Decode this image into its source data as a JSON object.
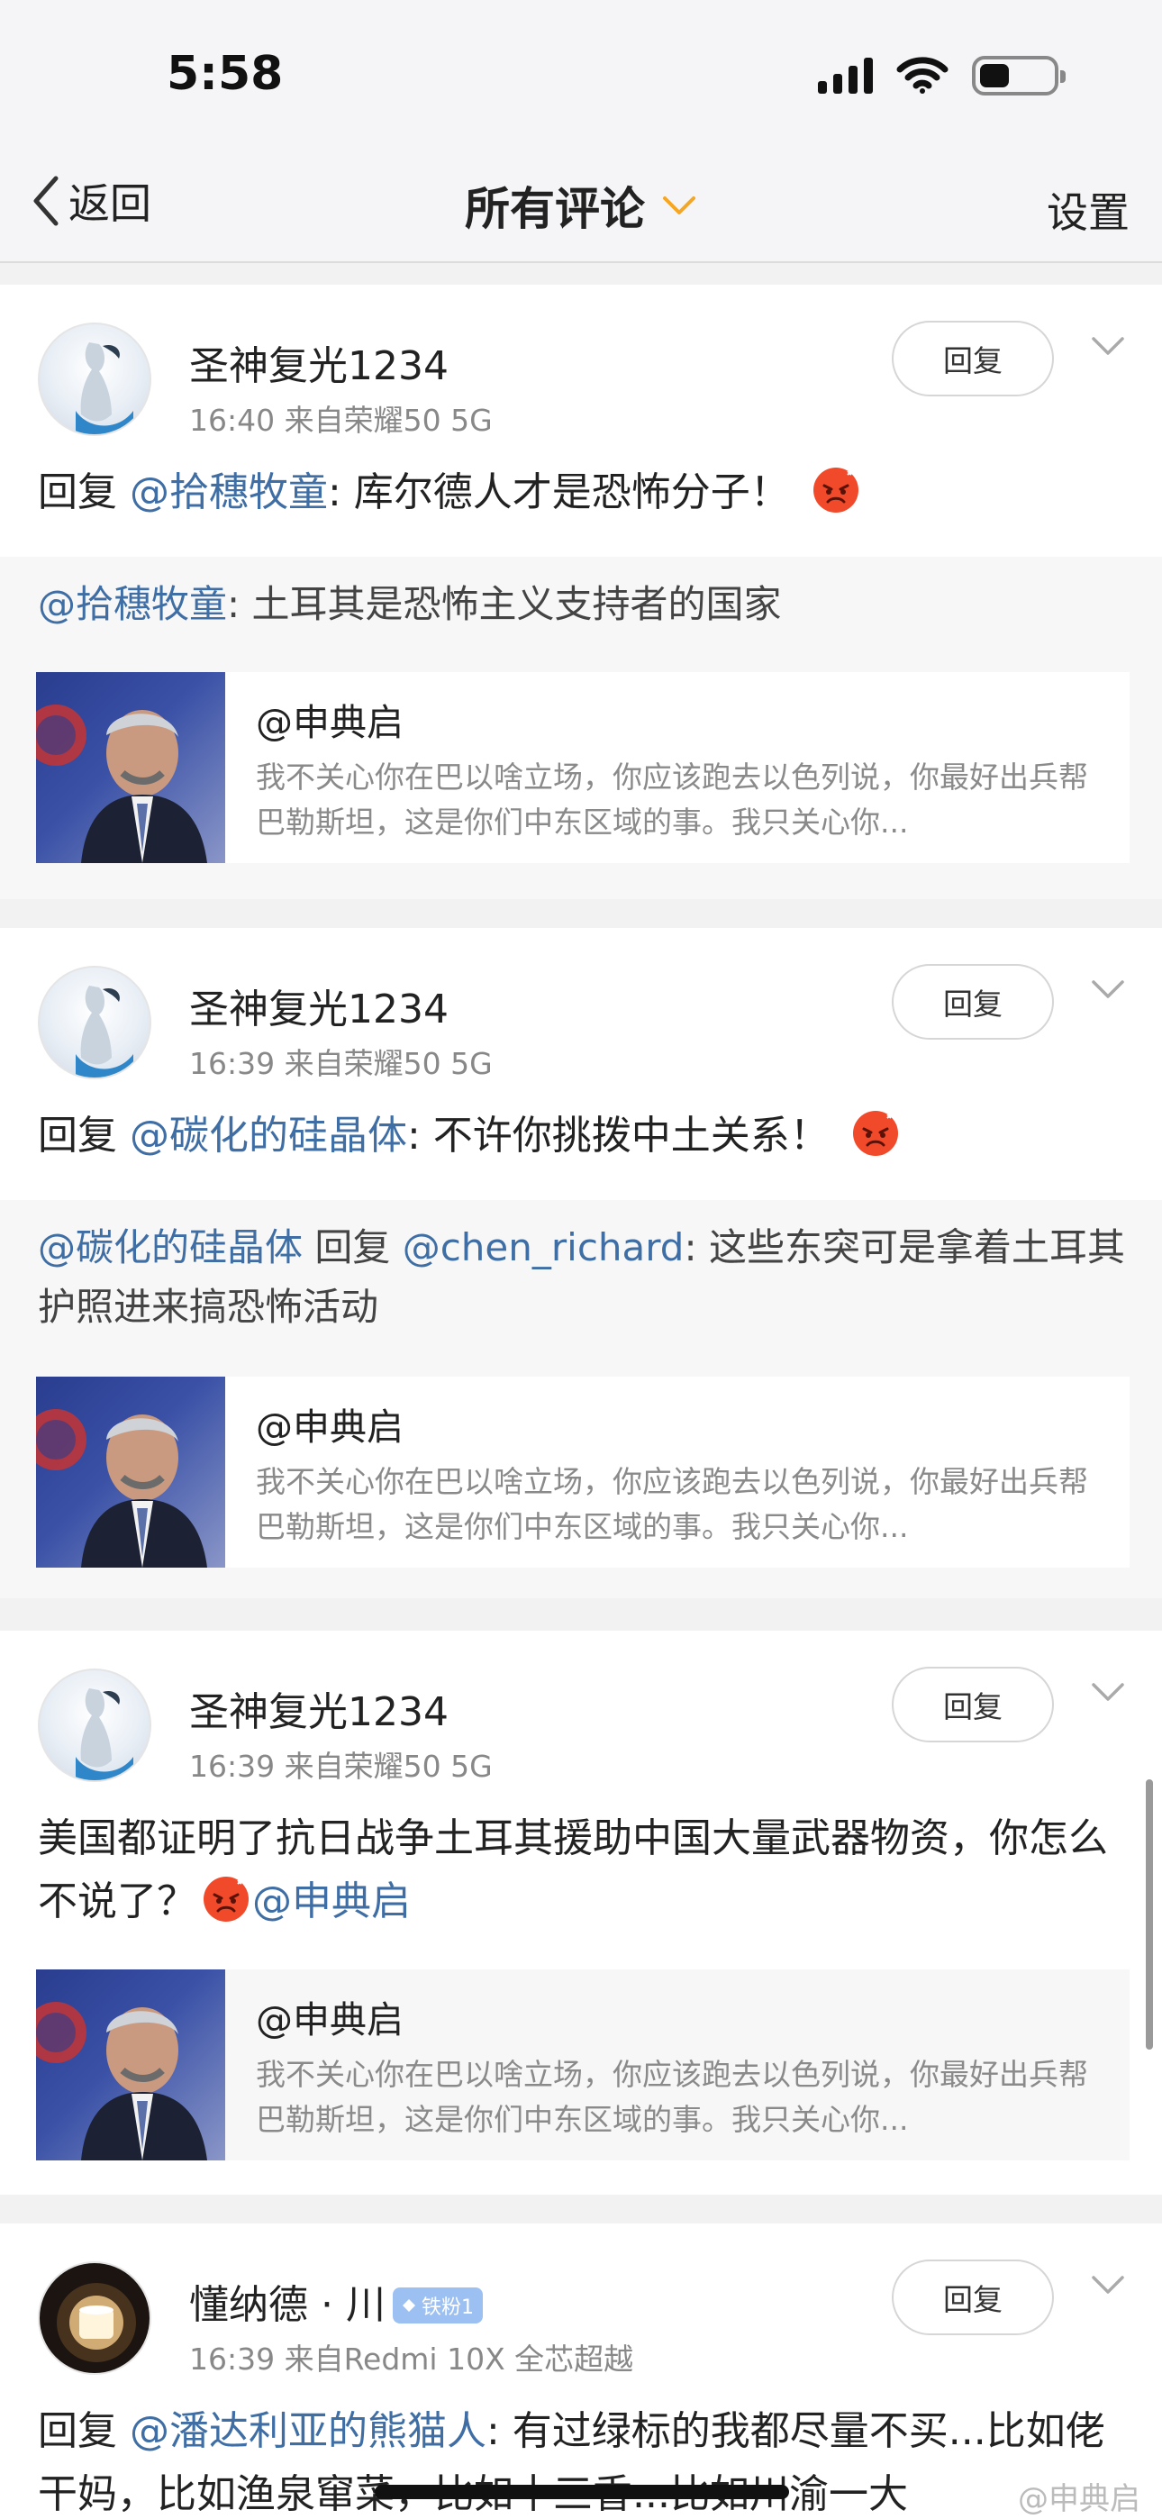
{
  "status_bar": {
    "time": "5:58",
    "battery_level": 0.3
  },
  "nav": {
    "back_label": "返回",
    "title": "所有评论",
    "settings_label": "设置"
  },
  "comments": [
    {
      "username": "圣神复光1234",
      "meta": "16:40   来自荣耀50 5G",
      "reply_label": "回复",
      "content_prefix": "回复",
      "content_mention": "@拾穗牧童",
      "content_text": ": 库尔德人才是恐怖分子！",
      "quote_mention": "@拾穗牧童",
      "quote_text": ": 土耳其是恐怖主义支持者的国家",
      "share_at": "@申典启",
      "share_desc": "我不关心你在巴以啥立场，你应该跑去以色列说，你最好出兵帮巴勒斯坦，这是你们中东区域的事。我只关心你..."
    },
    {
      "username": "圣神复光1234",
      "meta": "16:39   来自荣耀50 5G",
      "reply_label": "回复",
      "content_prefix": "回复",
      "content_mention": "@碳化的硅晶体",
      "content_text": ": 不许你挑拨中土关系！",
      "quote_mention": "@碳化的硅晶体",
      "quote_mid": " 回复 ",
      "quote_mention2": "@chen_richard",
      "quote_text": ": 这些东突可是拿着土耳其护照进来搞恐怖活动",
      "share_at": "@申典启",
      "share_desc": "我不关心你在巴以啥立场，你应该跑去以色列说，你最好出兵帮巴勒斯坦，这是你们中东区域的事。我只关心你..."
    },
    {
      "username": "圣神复光1234",
      "meta": "16:39   来自荣耀50 5G",
      "reply_label": "回复",
      "content_text": "美国都证明了抗日战争土耳其援助中国大量武器物资，你怎么不说了？",
      "content_mention": "@申典启",
      "share_at": "@申典启",
      "share_desc": "我不关心你在巴以啥立场，你应该跑去以色列说，你最好出兵帮巴勒斯坦，这是你们中东区域的事。我只关心你..."
    },
    {
      "username": "懂纳德 · 川",
      "badge": "铁粉1",
      "meta": "16:39   来自Redmi 10X 全芯超越",
      "reply_label": "回复",
      "content_prefix": "回复",
      "content_mention": "@潘达利亚的熊猫人",
      "content_text": ": 有过绿标的我都尽量不买...比如佬干妈，比如渔泉窜菜，比如十三香...比如川渝一大"
    }
  ],
  "watermark": "@申典启",
  "colors": {
    "link": "#3f6ea5",
    "accent_chevron": "#f5a623",
    "background": "#f2f2f2"
  }
}
